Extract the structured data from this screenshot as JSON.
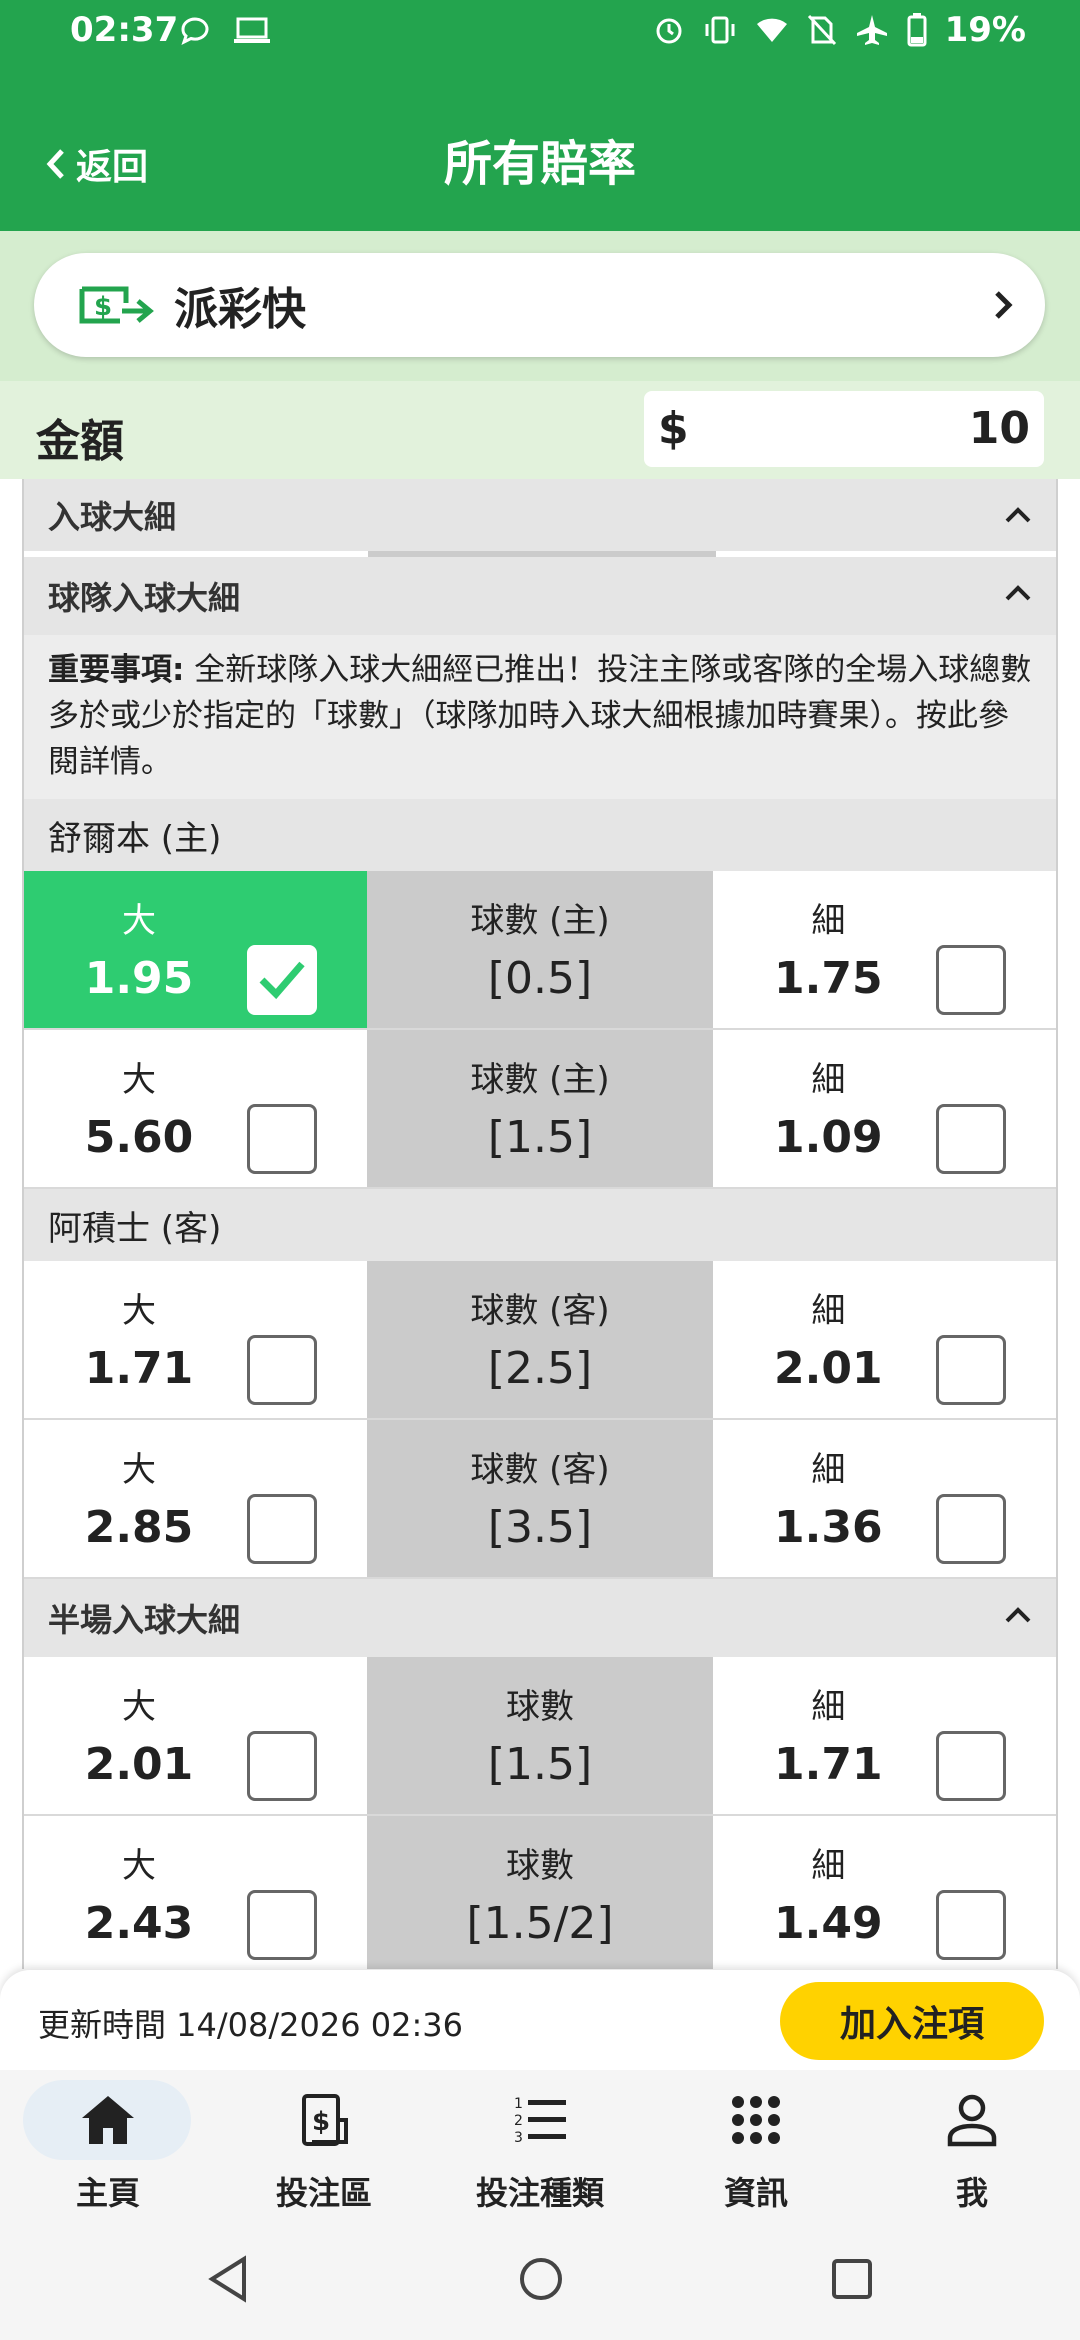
{
  "status_bar": {
    "time": "02:37",
    "battery": "19%"
  },
  "header": {
    "back_label": "返回",
    "title": "所有賠率"
  },
  "promo": {
    "label": "派彩快",
    "icon": "cash-transfer-icon"
  },
  "amount": {
    "label": "金額",
    "currency": "$",
    "value": "10"
  },
  "sections": {
    "total_goals": {
      "title": "入球大細"
    },
    "team_goals": {
      "title": "球隊入球大細",
      "notice_bold": "重要事項:",
      "notice_text": " 全新球隊入球大細經已推出！投注主隊或客隊的全場入球總數多於或少於指定的「球數」（球隊加時入球大細根據加時賽果）。按此參閱詳情。"
    },
    "home_team": {
      "name": "舒爾本 (主)",
      "rows": [
        {
          "high_label": "大",
          "high_odds": "1.95",
          "high_selected": true,
          "line_title": "球數 (主)",
          "line": "[0.5]",
          "low_label": "細",
          "low_odds": "1.75"
        },
        {
          "high_label": "大",
          "high_odds": "5.60",
          "high_selected": false,
          "line_title": "球數 (主)",
          "line": "[1.5]",
          "low_label": "細",
          "low_odds": "1.09"
        }
      ]
    },
    "away_team": {
      "name": "阿積士 (客)",
      "rows": [
        {
          "high_label": "大",
          "high_odds": "1.71",
          "line_title": "球數 (客)",
          "line": "[2.5]",
          "low_label": "細",
          "low_odds": "2.01"
        },
        {
          "high_label": "大",
          "high_odds": "2.85",
          "line_title": "球數 (客)",
          "line": "[3.5]",
          "low_label": "細",
          "low_odds": "1.36"
        }
      ]
    },
    "half_time": {
      "title": "半場入球大細",
      "rows": [
        {
          "high_label": "大",
          "high_odds": "2.01",
          "line_title": "球數",
          "line": "[1.5]",
          "low_label": "細",
          "low_odds": "1.71"
        },
        {
          "high_label": "大",
          "high_odds": "2.43",
          "line_title": "球數",
          "line": "[1.5/2]",
          "low_label": "細",
          "low_odds": "1.49"
        }
      ]
    }
  },
  "bottom_sheet": {
    "update_time": "更新時間 14/08/2026 02:36",
    "add_bet_label": "加入注項"
  },
  "bottom_nav": {
    "items": [
      {
        "label": "主頁",
        "icon": "home-icon",
        "active": true
      },
      {
        "label": "投注區",
        "icon": "bet-slip-icon",
        "active": false
      },
      {
        "label": "投注種類",
        "icon": "numbered-list-icon",
        "active": false
      },
      {
        "label": "資訊",
        "icon": "grid-dots-icon",
        "active": false
      },
      {
        "label": "我",
        "icon": "person-icon",
        "active": false
      }
    ]
  },
  "colors": {
    "header_green": "#23a44e",
    "selected_green": "#2ecc71",
    "accent_yellow": "#ffd200"
  }
}
